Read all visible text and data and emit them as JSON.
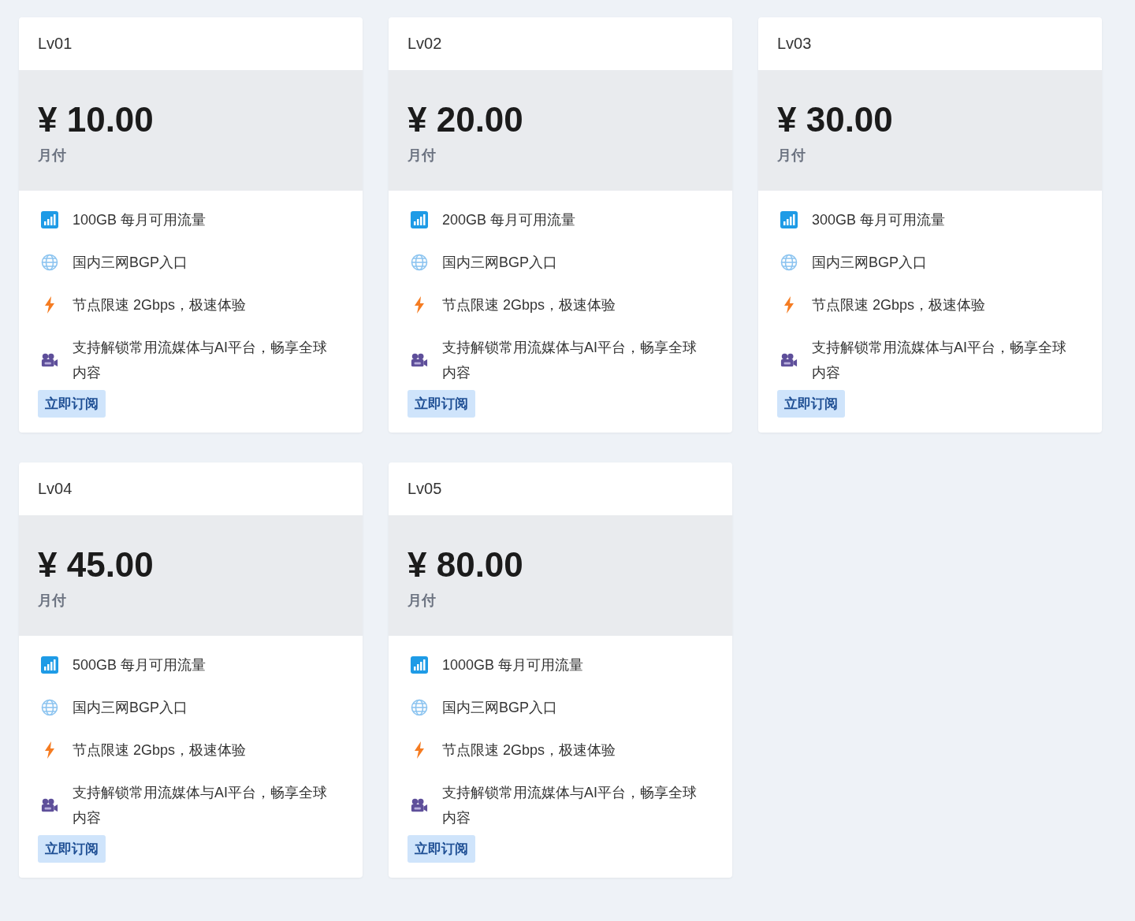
{
  "plans": [
    {
      "name": "Lv01",
      "price": "¥ 10.00",
      "period": "月付",
      "features": [
        {
          "kind": "traffic",
          "text": "100GB 每月可用流量"
        },
        {
          "kind": "network",
          "text": "国内三网BGP入口"
        },
        {
          "kind": "speed",
          "text": "节点限速 2Gbps，极速体验"
        },
        {
          "kind": "media",
          "text": "支持解锁常用流媒体与AI平台，畅享全球内容"
        }
      ],
      "button": "立即订阅"
    },
    {
      "name": "Lv02",
      "price": "¥ 20.00",
      "period": "月付",
      "features": [
        {
          "kind": "traffic",
          "text": "200GB 每月可用流量"
        },
        {
          "kind": "network",
          "text": "国内三网BGP入口"
        },
        {
          "kind": "speed",
          "text": "节点限速 2Gbps，极速体验"
        },
        {
          "kind": "media",
          "text": "支持解锁常用流媒体与AI平台，畅享全球内容"
        }
      ],
      "button": "立即订阅"
    },
    {
      "name": "Lv03",
      "price": "¥ 30.00",
      "period": "月付",
      "features": [
        {
          "kind": "traffic",
          "text": "300GB 每月可用流量"
        },
        {
          "kind": "network",
          "text": "国内三网BGP入口"
        },
        {
          "kind": "speed",
          "text": "节点限速 2Gbps，极速体验"
        },
        {
          "kind": "media",
          "text": "支持解锁常用流媒体与AI平台，畅享全球内容"
        }
      ],
      "button": "立即订阅"
    },
    {
      "name": "Lv04",
      "price": "¥ 45.00",
      "period": "月付",
      "features": [
        {
          "kind": "traffic",
          "text": "500GB 每月可用流量"
        },
        {
          "kind": "network",
          "text": "国内三网BGP入口"
        },
        {
          "kind": "speed",
          "text": "节点限速 2Gbps，极速体验"
        },
        {
          "kind": "media",
          "text": "支持解锁常用流媒体与AI平台，畅享全球内容"
        }
      ],
      "button": "立即订阅"
    },
    {
      "name": "Lv05",
      "price": "¥ 80.00",
      "period": "月付",
      "features": [
        {
          "kind": "traffic",
          "text": "1000GB 每月可用流量"
        },
        {
          "kind": "network",
          "text": "国内三网BGP入口"
        },
        {
          "kind": "speed",
          "text": "节点限速 2Gbps，极速体验"
        },
        {
          "kind": "media",
          "text": "支持解锁常用流媒体与AI平台，畅享全球内容"
        }
      ],
      "button": "立即订阅"
    }
  ]
}
